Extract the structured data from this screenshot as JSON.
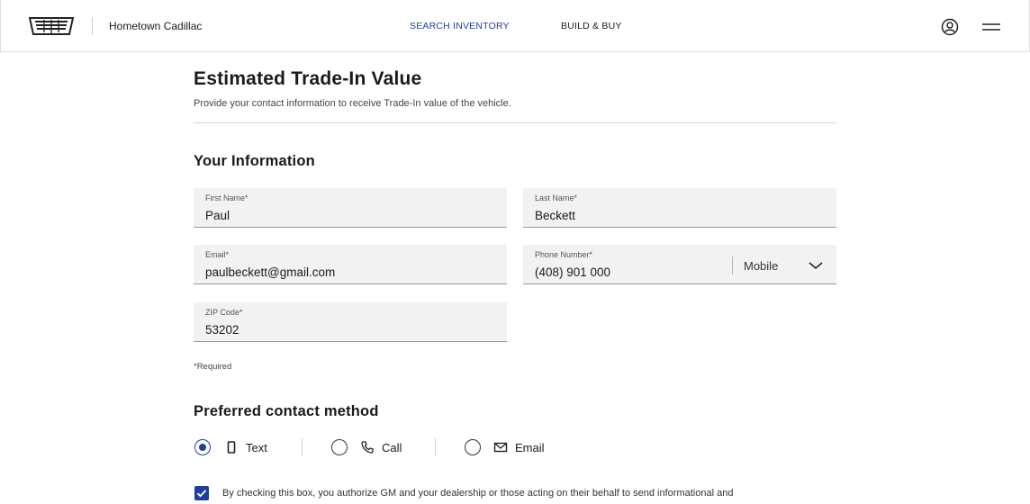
{
  "header": {
    "logo_icon": "cadillac-crest-logo",
    "dealer_name": "Hometown Cadillac",
    "nav": [
      {
        "label": "SEARCH INVENTORY",
        "active": true
      },
      {
        "label": "BUILD & BUY",
        "active": false
      }
    ],
    "account_icon": "account-icon",
    "menu_icon": "hamburger-menu-icon"
  },
  "page": {
    "title": "Estimated Trade-In Value",
    "subtitle": "Provide your contact information to receive Trade-In value of the vehicle."
  },
  "your_info": {
    "heading": "Your Information",
    "first_name": {
      "label": "First Name*",
      "value": "Paul"
    },
    "last_name": {
      "label": "Last Name*",
      "value": "Beckett"
    },
    "email": {
      "label": "Email*",
      "value": "paulbeckett@gmail.com"
    },
    "phone": {
      "label": "Phone Number*",
      "value": "(408) 901 000",
      "type": "Mobile"
    },
    "zip": {
      "label": "ZIP Code*",
      "value": "53202"
    },
    "required_note": "*Required"
  },
  "contact_method": {
    "heading": "Preferred contact method",
    "options": [
      {
        "label": "Text",
        "icon": "phone-device-icon",
        "selected": true
      },
      {
        "label": "Call",
        "icon": "phone-handset-icon",
        "selected": false
      },
      {
        "label": "Email",
        "icon": "envelope-icon",
        "selected": false
      }
    ]
  },
  "consent": {
    "checked": true,
    "text": "By checking this box, you authorize GM and your dealership or those acting on their behalf to send informational and"
  },
  "colors": {
    "accent": "#1f3f9a",
    "field_bg": "#f2f2f2"
  }
}
